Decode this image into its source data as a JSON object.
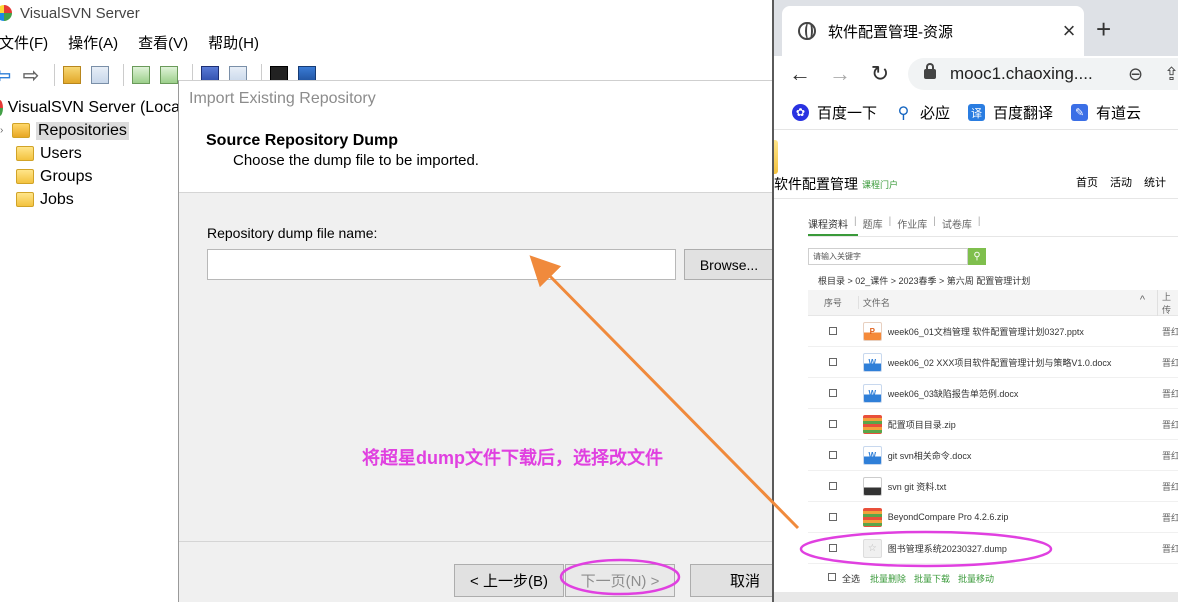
{
  "svn": {
    "title": "VisualSVN Server",
    "menu": [
      "文件(F)",
      "操作(A)",
      "查看(V)",
      "帮助(H)"
    ],
    "tree": {
      "root": "VisualSVN Server (Loca",
      "repositories": "Repositories",
      "users": "Users",
      "groups": "Groups",
      "jobs": "Jobs"
    }
  },
  "dialog": {
    "title": "Import Existing Repository",
    "heading": "Source Repository Dump",
    "subheading": "Choose the dump file to be imported.",
    "dump_label": "Repository dump file name:",
    "dump_value": "",
    "browse_label": "Browse...",
    "back_label": "< 上一步(B)",
    "next_label": "下一页(N) >",
    "cancel_label": "取消"
  },
  "annotation": {
    "text": "将超星dump文件下载后，选择改文件",
    "color": "#e040e0",
    "arrow_color": "#f08a3c"
  },
  "browser": {
    "tab_title": "软件配置管理-资源",
    "new_tab": "+",
    "url": "mooc1.chaoxing....",
    "bookmarks": [
      "百度一下",
      "必应",
      "百度翻译",
      "有道云"
    ]
  },
  "site": {
    "name": "软件配置管理",
    "sub": "课程门户",
    "nav": [
      "首页",
      "活动",
      "统计"
    ],
    "course_tabs": [
      "课程资料",
      "题库",
      "作业库",
      "试卷库"
    ],
    "keyword_placeholder": "请输入关键字",
    "breadcrumb": "根目录 >  02_课件 >  2023春季 >  第六周 配置管理计划",
    "table": {
      "col_no": "序号",
      "col_name": "文件名",
      "col_upload": "上传",
      "rows": [
        {
          "type": "P",
          "name": "week06_01文档管理 软件配置管理计划0327.pptx",
          "up": "晋红"
        },
        {
          "type": "W",
          "name": "week06_02 XXX项目软件配置管理计划与策略V1.0.docx",
          "up": "晋红"
        },
        {
          "type": "W",
          "name": "week06_03缺陷报告单范例.docx",
          "up": "晋红"
        },
        {
          "type": "Z",
          "name": "配置项目目录.zip",
          "up": "晋红"
        },
        {
          "type": "W",
          "name": "git svn相关命令.docx",
          "up": "晋红"
        },
        {
          "type": "T",
          "name": "svn git 资料.txt",
          "up": "晋红"
        },
        {
          "type": "Z",
          "name": "BeyondCompare Pro 4.2.6.zip",
          "up": "晋红"
        },
        {
          "type": "☆",
          "name": "图书管理系统20230327.dump",
          "up": "晋红"
        }
      ]
    },
    "bulk": {
      "select_all": "全选",
      "delete": "批量删除",
      "download": "批量下载",
      "move": "批量移动"
    }
  }
}
